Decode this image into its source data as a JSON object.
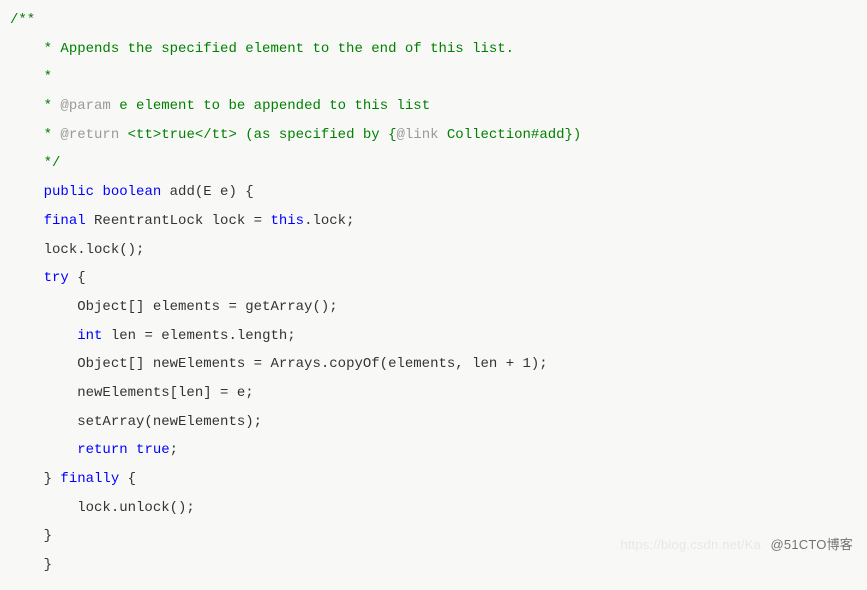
{
  "watermark": {
    "main": "@51CTO博客",
    "bg": "https://blog.csdn.net/Ka"
  },
  "lines": [
    {
      "indent": 0,
      "segs": [
        {
          "cls": "c-comment",
          "t": "/**"
        }
      ]
    },
    {
      "indent": 1,
      "segs": [
        {
          "cls": "c-comment",
          "t": "* Appends the specified element to the end of this list."
        }
      ]
    },
    {
      "indent": 1,
      "segs": [
        {
          "cls": "c-comment",
          "t": "*"
        }
      ]
    },
    {
      "indent": 1,
      "segs": [
        {
          "cls": "c-comment",
          "t": "* "
        },
        {
          "cls": "c-tag",
          "t": "@param"
        },
        {
          "cls": "c-comment",
          "t": " e element to be appended to this list"
        }
      ]
    },
    {
      "indent": 1,
      "segs": [
        {
          "cls": "c-comment",
          "t": "* "
        },
        {
          "cls": "c-tag",
          "t": "@return"
        },
        {
          "cls": "c-comment",
          "t": " <tt>true</tt> (as specified by {"
        },
        {
          "cls": "c-tag",
          "t": "@link"
        },
        {
          "cls": "c-comment",
          "t": " Collection#add})"
        }
      ]
    },
    {
      "indent": 1,
      "segs": [
        {
          "cls": "c-comment",
          "t": "*/"
        }
      ]
    },
    {
      "indent": 1,
      "segs": [
        {
          "cls": "c-keyword",
          "t": "public"
        },
        {
          "cls": "c-plain",
          "t": " "
        },
        {
          "cls": "c-keyword",
          "t": "boolean"
        },
        {
          "cls": "c-plain",
          "t": " add(E e) {"
        }
      ]
    },
    {
      "indent": 1,
      "segs": [
        {
          "cls": "c-keyword",
          "t": "final"
        },
        {
          "cls": "c-plain",
          "t": " ReentrantLock lock = "
        },
        {
          "cls": "c-keyword",
          "t": "this"
        },
        {
          "cls": "c-plain",
          "t": ".lock;"
        }
      ]
    },
    {
      "indent": 1,
      "segs": [
        {
          "cls": "c-plain",
          "t": "lock.lock();"
        }
      ]
    },
    {
      "indent": 1,
      "segs": [
        {
          "cls": "c-keyword",
          "t": "try"
        },
        {
          "cls": "c-plain",
          "t": " {"
        }
      ]
    },
    {
      "indent": 2,
      "segs": [
        {
          "cls": "c-plain",
          "t": "Object[] elements = getArray();"
        }
      ]
    },
    {
      "indent": 2,
      "segs": [
        {
          "cls": "c-keyword",
          "t": "int"
        },
        {
          "cls": "c-plain",
          "t": " len = elements.length;"
        }
      ]
    },
    {
      "indent": 2,
      "segs": [
        {
          "cls": "c-plain",
          "t": "Object[] newElements = Arrays.copyOf(elements, len + 1);"
        }
      ]
    },
    {
      "indent": 2,
      "segs": [
        {
          "cls": "c-plain",
          "t": "newElements[len] = e;"
        }
      ]
    },
    {
      "indent": 2,
      "segs": [
        {
          "cls": "c-plain",
          "t": "setArray(newElements);"
        }
      ]
    },
    {
      "indent": 2,
      "segs": [
        {
          "cls": "c-keyword",
          "t": "return"
        },
        {
          "cls": "c-plain",
          "t": " "
        },
        {
          "cls": "c-keyword",
          "t": "true"
        },
        {
          "cls": "c-plain",
          "t": ";"
        }
      ]
    },
    {
      "indent": 1,
      "segs": [
        {
          "cls": "c-plain",
          "t": "} "
        },
        {
          "cls": "c-keyword",
          "t": "finally"
        },
        {
          "cls": "c-plain",
          "t": " {"
        }
      ]
    },
    {
      "indent": 2,
      "segs": [
        {
          "cls": "c-plain",
          "t": "lock.unlock();"
        }
      ]
    },
    {
      "indent": 1,
      "segs": [
        {
          "cls": "c-plain",
          "t": "}"
        }
      ]
    },
    {
      "indent": 1,
      "segs": [
        {
          "cls": "c-plain",
          "t": "}"
        }
      ]
    }
  ]
}
